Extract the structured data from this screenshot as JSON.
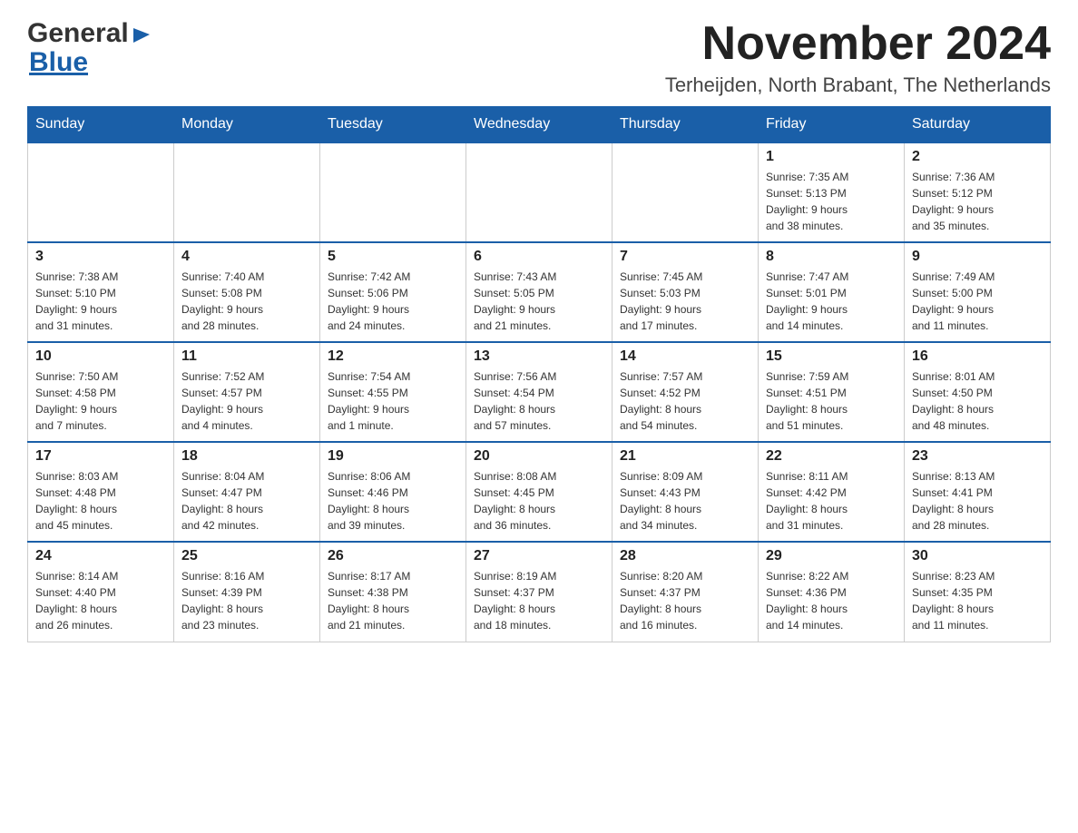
{
  "header": {
    "logo": {
      "general": "General",
      "blue": "Blue",
      "arrow": "▶"
    },
    "title": "November 2024",
    "location": "Terheijden, North Brabant, The Netherlands"
  },
  "calendar": {
    "days_of_week": [
      "Sunday",
      "Monday",
      "Tuesday",
      "Wednesday",
      "Thursday",
      "Friday",
      "Saturday"
    ],
    "weeks": [
      [
        {
          "day": "",
          "info": ""
        },
        {
          "day": "",
          "info": ""
        },
        {
          "day": "",
          "info": ""
        },
        {
          "day": "",
          "info": ""
        },
        {
          "day": "",
          "info": ""
        },
        {
          "day": "1",
          "info": "Sunrise: 7:35 AM\nSunset: 5:13 PM\nDaylight: 9 hours\nand 38 minutes."
        },
        {
          "day": "2",
          "info": "Sunrise: 7:36 AM\nSunset: 5:12 PM\nDaylight: 9 hours\nand 35 minutes."
        }
      ],
      [
        {
          "day": "3",
          "info": "Sunrise: 7:38 AM\nSunset: 5:10 PM\nDaylight: 9 hours\nand 31 minutes."
        },
        {
          "day": "4",
          "info": "Sunrise: 7:40 AM\nSunset: 5:08 PM\nDaylight: 9 hours\nand 28 minutes."
        },
        {
          "day": "5",
          "info": "Sunrise: 7:42 AM\nSunset: 5:06 PM\nDaylight: 9 hours\nand 24 minutes."
        },
        {
          "day": "6",
          "info": "Sunrise: 7:43 AM\nSunset: 5:05 PM\nDaylight: 9 hours\nand 21 minutes."
        },
        {
          "day": "7",
          "info": "Sunrise: 7:45 AM\nSunset: 5:03 PM\nDaylight: 9 hours\nand 17 minutes."
        },
        {
          "day": "8",
          "info": "Sunrise: 7:47 AM\nSunset: 5:01 PM\nDaylight: 9 hours\nand 14 minutes."
        },
        {
          "day": "9",
          "info": "Sunrise: 7:49 AM\nSunset: 5:00 PM\nDaylight: 9 hours\nand 11 minutes."
        }
      ],
      [
        {
          "day": "10",
          "info": "Sunrise: 7:50 AM\nSunset: 4:58 PM\nDaylight: 9 hours\nand 7 minutes."
        },
        {
          "day": "11",
          "info": "Sunrise: 7:52 AM\nSunset: 4:57 PM\nDaylight: 9 hours\nand 4 minutes."
        },
        {
          "day": "12",
          "info": "Sunrise: 7:54 AM\nSunset: 4:55 PM\nDaylight: 9 hours\nand 1 minute."
        },
        {
          "day": "13",
          "info": "Sunrise: 7:56 AM\nSunset: 4:54 PM\nDaylight: 8 hours\nand 57 minutes."
        },
        {
          "day": "14",
          "info": "Sunrise: 7:57 AM\nSunset: 4:52 PM\nDaylight: 8 hours\nand 54 minutes."
        },
        {
          "day": "15",
          "info": "Sunrise: 7:59 AM\nSunset: 4:51 PM\nDaylight: 8 hours\nand 51 minutes."
        },
        {
          "day": "16",
          "info": "Sunrise: 8:01 AM\nSunset: 4:50 PM\nDaylight: 8 hours\nand 48 minutes."
        }
      ],
      [
        {
          "day": "17",
          "info": "Sunrise: 8:03 AM\nSunset: 4:48 PM\nDaylight: 8 hours\nand 45 minutes."
        },
        {
          "day": "18",
          "info": "Sunrise: 8:04 AM\nSunset: 4:47 PM\nDaylight: 8 hours\nand 42 minutes."
        },
        {
          "day": "19",
          "info": "Sunrise: 8:06 AM\nSunset: 4:46 PM\nDaylight: 8 hours\nand 39 minutes."
        },
        {
          "day": "20",
          "info": "Sunrise: 8:08 AM\nSunset: 4:45 PM\nDaylight: 8 hours\nand 36 minutes."
        },
        {
          "day": "21",
          "info": "Sunrise: 8:09 AM\nSunset: 4:43 PM\nDaylight: 8 hours\nand 34 minutes."
        },
        {
          "day": "22",
          "info": "Sunrise: 8:11 AM\nSunset: 4:42 PM\nDaylight: 8 hours\nand 31 minutes."
        },
        {
          "day": "23",
          "info": "Sunrise: 8:13 AM\nSunset: 4:41 PM\nDaylight: 8 hours\nand 28 minutes."
        }
      ],
      [
        {
          "day": "24",
          "info": "Sunrise: 8:14 AM\nSunset: 4:40 PM\nDaylight: 8 hours\nand 26 minutes."
        },
        {
          "day": "25",
          "info": "Sunrise: 8:16 AM\nSunset: 4:39 PM\nDaylight: 8 hours\nand 23 minutes."
        },
        {
          "day": "26",
          "info": "Sunrise: 8:17 AM\nSunset: 4:38 PM\nDaylight: 8 hours\nand 21 minutes."
        },
        {
          "day": "27",
          "info": "Sunrise: 8:19 AM\nSunset: 4:37 PM\nDaylight: 8 hours\nand 18 minutes."
        },
        {
          "day": "28",
          "info": "Sunrise: 8:20 AM\nSunset: 4:37 PM\nDaylight: 8 hours\nand 16 minutes."
        },
        {
          "day": "29",
          "info": "Sunrise: 8:22 AM\nSunset: 4:36 PM\nDaylight: 8 hours\nand 14 minutes."
        },
        {
          "day": "30",
          "info": "Sunrise: 8:23 AM\nSunset: 4:35 PM\nDaylight: 8 hours\nand 11 minutes."
        }
      ]
    ]
  }
}
